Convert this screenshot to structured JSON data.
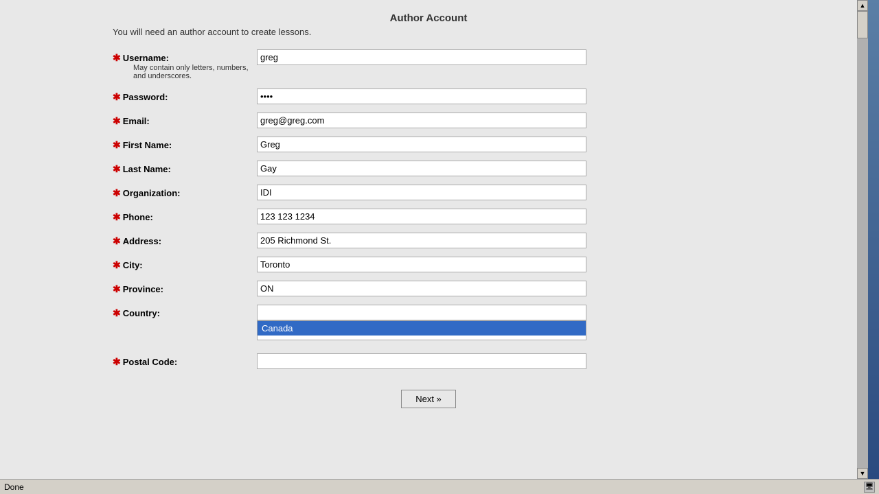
{
  "page": {
    "title": "Author Account",
    "subtitle": "You will need an author account to create lessons."
  },
  "form": {
    "username_label": "Username:",
    "username_note": "May contain only letters, numbers, and underscores.",
    "username_value": "greg",
    "password_label": "Password:",
    "password_value": "greg",
    "email_label": "Email:",
    "email_value": "greg@greg.com",
    "firstname_label": "First Name:",
    "firstname_value": "Greg",
    "lastname_label": "Last Name:",
    "lastname_value": "Gay",
    "organization_label": "Organization:",
    "organization_value": "IDI",
    "phone_label": "Phone:",
    "phone_value": "123 123 1234",
    "address_label": "Address:",
    "address_value": "205 Richmond St.",
    "city_label": "City:",
    "city_value": "Toronto",
    "province_label": "Province:",
    "province_value": "ON",
    "country_label": "Country:",
    "country_value": "",
    "country_dropdown_selected": "Canada",
    "postalcode_label": "Postal Code:",
    "postalcode_value": ""
  },
  "buttons": {
    "next_label": "Next »"
  },
  "status": {
    "text": "Done"
  },
  "icons": {
    "scroll_up": "▲",
    "scroll_down": "▼",
    "status_icon": "🖥"
  }
}
